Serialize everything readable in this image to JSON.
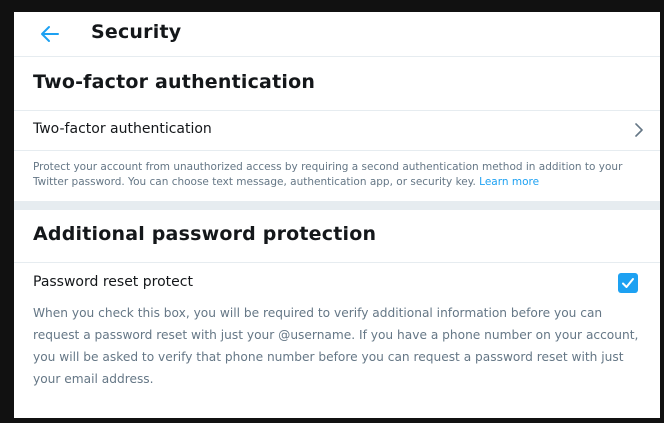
{
  "header": {
    "title": "Security"
  },
  "sections": [
    {
      "title": "Two-factor authentication",
      "row_label": "Two-factor authentication",
      "note": "Protect your account from unauthorized access by requiring a second authentication method in addition to your Twitter password. You can choose text message, authentication app, or security key.",
      "link": "Learn more"
    },
    {
      "title": "Additional password protection",
      "row_label": "Password reset protect",
      "checked": true,
      "note": "When you check this box, you will be required to verify additional information before you can request a password reset with just your @username. If you have a phone number on your account, you will be asked to verify that phone number before you can request a password reset with just your email address."
    }
  ],
  "colors": {
    "accent": "#1da1f2",
    "text": "#14171a",
    "muted": "#657786",
    "border": "#e6ecf0"
  },
  "icons": {
    "back": "arrow-left-icon",
    "chevron": "chevron-right-icon",
    "check": "checkmark-icon"
  }
}
